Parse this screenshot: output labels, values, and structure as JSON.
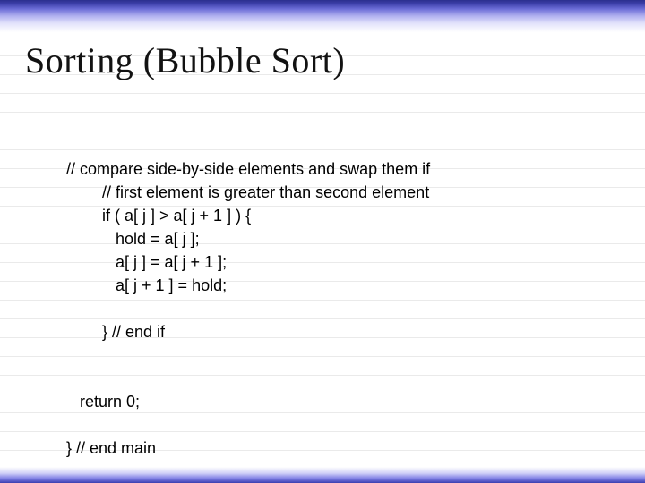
{
  "title": "Sorting (Bubble Sort)",
  "code": {
    "l1": "// compare side-by-side elements and swap them if",
    "l2": "        // first element is greater than second element",
    "l3": "        if ( a[ j ] > a[ j + 1 ] ) {",
    "l4": "           hold = a[ j ];",
    "l5": "           a[ j ] = a[ j + 1 ];",
    "l6": "           a[ j + 1 ] = hold;",
    "l7": "",
    "l8": "        } // end if",
    "l9": "",
    "l10": "",
    "l11": "   return 0;",
    "l12": "",
    "l13": "} // end main"
  }
}
